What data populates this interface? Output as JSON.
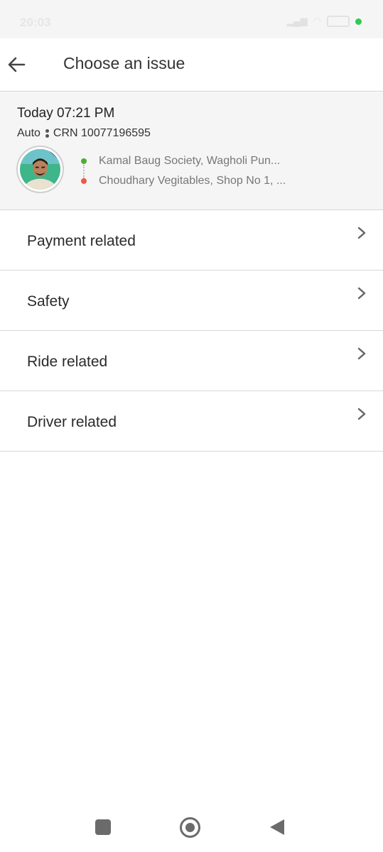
{
  "status_bar": {
    "time": "20:03",
    "icons": [
      "whatsapp-icon",
      "more-dots-icon",
      "vibrate-icon",
      "bluetooth-icon",
      "signal-icon",
      "signal-icon",
      "wifi-icon",
      "battery-icon"
    ],
    "dot_color": "#2ecc52"
  },
  "header": {
    "title": "Choose an issue"
  },
  "ride": {
    "time": "Today 07:21 PM",
    "vehicle": "Auto",
    "crn": "CRN 10077196595",
    "pickup": "Kamal Baug Society, Wagholi Pun...",
    "drop": "Choudhary Vegitables, Shop No 1, ..."
  },
  "issues": [
    {
      "label": "Payment related"
    },
    {
      "label": "Safety"
    },
    {
      "label": "Ride related"
    },
    {
      "label": "Driver related"
    }
  ],
  "colors": {
    "pickup_dot": "#4caf30",
    "drop_dot": "#f0574a",
    "card_bg": "#f5f5f5"
  }
}
